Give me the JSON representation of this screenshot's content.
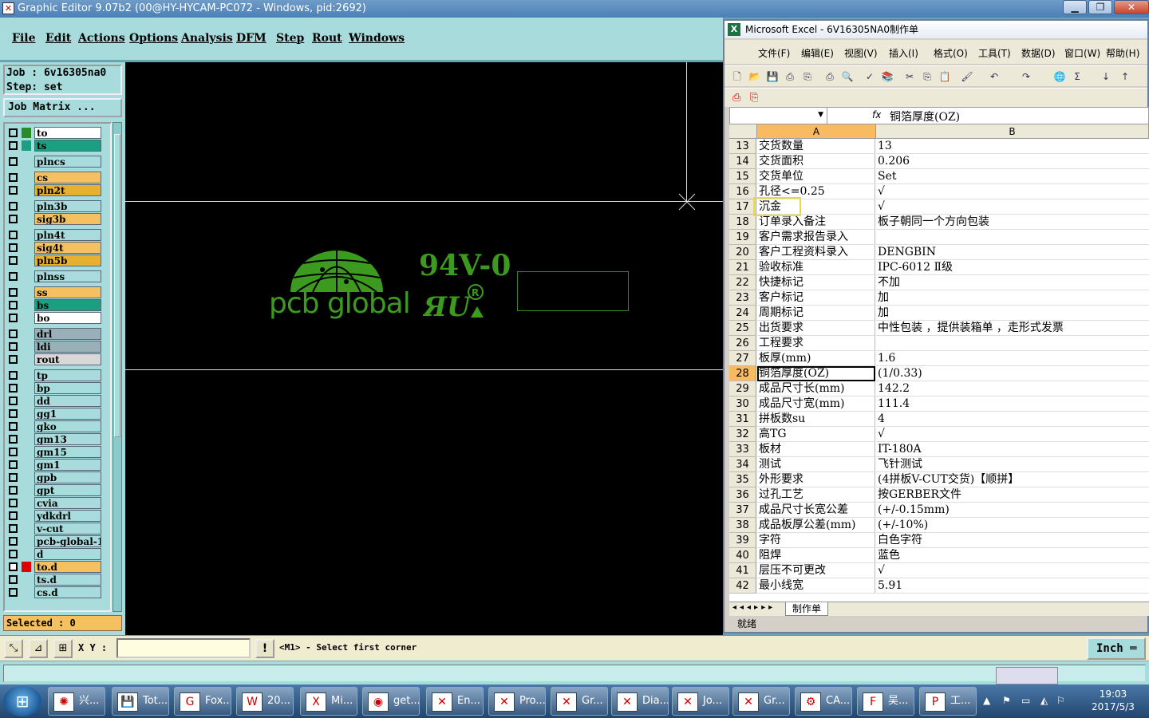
{
  "genesis": {
    "title": "Graphic Editor 9.07b2 (00@HY-HYCAM-PC072 - Windows, pid:2692)",
    "menu": [
      "File",
      "Edit",
      "Actions",
      "Options",
      "Analysis",
      "DFM",
      "Step",
      "Rout",
      "Windows"
    ],
    "job_label": "Job : 6v16305na0",
    "step_label": "Step: set",
    "job_matrix": "Job Matrix ...",
    "layers": [
      {
        "name": "to",
        "color": "#ffffff",
        "swatch": "#2a8a2a"
      },
      {
        "name": "ts",
        "color": "#1aa080",
        "swatch": "#1aa080"
      },
      {
        "name": "plncs",
        "color": "#a8dcdc",
        "swatch": ""
      },
      {
        "name": "cs",
        "color": "#f4c060",
        "swatch": ""
      },
      {
        "name": "pln2t",
        "color": "#e8b030",
        "swatch": ""
      },
      {
        "name": "pln3b",
        "color": "#a8dcdc",
        "swatch": ""
      },
      {
        "name": "sig3b",
        "color": "#f4c060",
        "swatch": ""
      },
      {
        "name": "pln4t",
        "color": "#a8dcdc",
        "swatch": ""
      },
      {
        "name": "sig4t",
        "color": "#f4c060",
        "swatch": ""
      },
      {
        "name": "pln5b",
        "color": "#e8b030",
        "swatch": ""
      },
      {
        "name": "plnss",
        "color": "#a8dcdc",
        "swatch": ""
      },
      {
        "name": "ss",
        "color": "#f4c060",
        "swatch": ""
      },
      {
        "name": "bs",
        "color": "#1aa080",
        "swatch": ""
      },
      {
        "name": "bo",
        "color": "#ffffff",
        "swatch": ""
      },
      {
        "name": "drl",
        "color": "#9ab0b8",
        "swatch": ""
      },
      {
        "name": "ldi",
        "color": "#9ab0b8",
        "swatch": ""
      },
      {
        "name": "rout",
        "color": "#d8d8d8",
        "swatch": ""
      },
      {
        "name": "tp",
        "color": "#a8dcdc",
        "swatch": ""
      },
      {
        "name": "bp",
        "color": "#a8dcdc",
        "swatch": ""
      },
      {
        "name": "dd",
        "color": "#a8dcdc",
        "swatch": ""
      },
      {
        "name": "gg1",
        "color": "#a8dcdc",
        "swatch": ""
      },
      {
        "name": "gko",
        "color": "#a8dcdc",
        "swatch": ""
      },
      {
        "name": "gm13",
        "color": "#a8dcdc",
        "swatch": ""
      },
      {
        "name": "gm15",
        "color": "#a8dcdc",
        "swatch": ""
      },
      {
        "name": "gm1",
        "color": "#a8dcdc",
        "swatch": ""
      },
      {
        "name": "gpb",
        "color": "#a8dcdc",
        "swatch": ""
      },
      {
        "name": "gpt",
        "color": "#a8dcdc",
        "swatch": ""
      },
      {
        "name": "cvia",
        "color": "#a8dcdc",
        "swatch": ""
      },
      {
        "name": "ydkdrl",
        "color": "#a8dcdc",
        "swatch": ""
      },
      {
        "name": "v-cut",
        "color": "#a8dcdc",
        "swatch": ""
      },
      {
        "name": "pcb-global-1",
        "color": "#a8dcdc",
        "swatch": ""
      },
      {
        "name": "d",
        "color": "#a8dcdc",
        "swatch": ""
      },
      {
        "name": "to.d",
        "color": "#f4c060",
        "swatch": "#e00000"
      },
      {
        "name": "ts.d",
        "color": "#a8dcdc",
        "swatch": ""
      },
      {
        "name": "cs.d",
        "color": "#a8dcdc",
        "swatch": ""
      }
    ],
    "selected": "Selected : 0",
    "canvas_logo": "pcb global",
    "canvas_mark": "94V-0",
    "xy_label": "X Y :",
    "prompt": "<M1> - Select first corner",
    "units": "Inch"
  },
  "excel": {
    "title": "Microsoft Excel - 6V16305NA0制作单",
    "menu": [
      "文件(F)",
      "编辑(E)",
      "视图(V)",
      "插入(I)",
      "格式(O)",
      "工具(T)",
      "数据(D)",
      "窗口(W)",
      "帮助(H)"
    ],
    "formula_value": "铜箔厚度(OZ)",
    "col_a": "A",
    "col_b": "B",
    "rows": [
      {
        "n": "13",
        "a": "交货数量",
        "b": "13"
      },
      {
        "n": "14",
        "a": "交货面积",
        "b": "0.206"
      },
      {
        "n": "15",
        "a": "交货单位",
        "b": "Set"
      },
      {
        "n": "16",
        "a": "孔径<=0.25",
        "b": "√"
      },
      {
        "n": "17",
        "a": "沉金",
        "b": "√"
      },
      {
        "n": "18",
        "a": "订单录入备注",
        "b": "板子朝同一个方向包装"
      },
      {
        "n": "19",
        "a": "客户需求报告录入",
        "b": ""
      },
      {
        "n": "20",
        "a": "客户工程资料录入",
        "b": "DENGBIN"
      },
      {
        "n": "21",
        "a": "验收标准",
        "b": "IPC-6012 Ⅱ级"
      },
      {
        "n": "22",
        "a": "快捷标记",
        "b": "不加"
      },
      {
        "n": "23",
        "a": "客户标记",
        "b": "加"
      },
      {
        "n": "24",
        "a": "周期标记",
        "b": "加"
      },
      {
        "n": "25",
        "a": "出货要求",
        "b": "中性包装 ，提供装箱单 ，走形式发票"
      },
      {
        "n": "26",
        "a": "工程要求",
        "b": ""
      },
      {
        "n": "27",
        "a": "板厚(mm)",
        "b": "1.6"
      },
      {
        "n": "28",
        "a": "铜箔厚度(OZ)",
        "b": "(1/0.33)"
      },
      {
        "n": "29",
        "a": "成品尺寸长(mm)",
        "b": "142.2"
      },
      {
        "n": "30",
        "a": "成品尺寸宽(mm)",
        "b": "111.4"
      },
      {
        "n": "31",
        "a": "拼板数su",
        "b": "4"
      },
      {
        "n": "32",
        "a": "高TG",
        "b": "√"
      },
      {
        "n": "33",
        "a": "板材",
        "b": "IT-180A"
      },
      {
        "n": "34",
        "a": "测试",
        "b": "飞针测试"
      },
      {
        "n": "35",
        "a": "外形要求",
        "b": "(4拼板V-CUT交货)【顺拼】"
      },
      {
        "n": "36",
        "a": "过孔工艺",
        "b": "按GERBER文件"
      },
      {
        "n": "37",
        "a": "成品尺寸长宽公差",
        "b": "(+/-0.15mm)"
      },
      {
        "n": "38",
        "a": "成品板厚公差(mm)",
        "b": "(+/-10%)"
      },
      {
        "n": "39",
        "a": "字符",
        "b": "白色字符"
      },
      {
        "n": "40",
        "a": "阻焊",
        "b": "蓝色"
      },
      {
        "n": "41",
        "a": "层压不可更改",
        "b": "√"
      },
      {
        "n": "42",
        "a": "最小线宽",
        "b": "5.91"
      }
    ],
    "sheet_tab": "制作单",
    "status": "就绪"
  },
  "taskbar": {
    "tasks": [
      "兴...",
      "Tot...",
      "Fox...",
      "20...",
      "Mi...",
      "get...",
      "En...",
      "Pro...",
      "Gr...",
      "Dia...",
      "Jo...",
      "Gr...",
      "CA...",
      "吴...",
      "工..."
    ],
    "time": "19:03",
    "date": "2017/5/3"
  }
}
